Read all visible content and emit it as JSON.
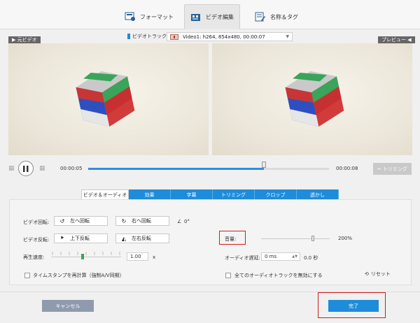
{
  "tabs": [
    {
      "label": "フォーマット",
      "icon": "format-icon"
    },
    {
      "label": "ビデオ編集",
      "icon": "video-edit-icon"
    },
    {
      "label": "名称＆タグ",
      "icon": "name-tag-icon"
    }
  ],
  "track": {
    "label": "ビデオトラック:",
    "value": "Video1: h264, 854x480, 00:00:07"
  },
  "preview": {
    "source_label": "元ビデオ",
    "preview_label": "プレビュー"
  },
  "player": {
    "current_time": "00:00:05",
    "end_time": "00:00:08",
    "trim_label": "トリミング",
    "progress": 0.73
  },
  "edit_tabs": [
    "ビデオ＆オーディオ",
    "効果",
    "字幕",
    "トリミング",
    "クロップ",
    "透かし"
  ],
  "rotate": {
    "label": "ビデオ回転:",
    "left": "左へ回転",
    "right": "右へ回転",
    "angle": "0°"
  },
  "flip": {
    "label": "ビデオ反転:",
    "vertical": "上下反転",
    "horizontal": "左右反転"
  },
  "volume": {
    "label": "音量:",
    "value": "200%",
    "level": 0.75
  },
  "speed": {
    "label": "再生速度:",
    "value": "1.00",
    "unit": "x"
  },
  "audio_delay": {
    "label": "オーディオ遅延:",
    "value": "0 ms",
    "readout": "0.0 秒"
  },
  "timestamp": {
    "label": "タイムスタンプを再計算（強制A/V同期）"
  },
  "disable_tracks": {
    "label": "全てのオーディオトラックを無効にする"
  },
  "reset_label": "リセット",
  "footer": {
    "cancel": "キャンセル",
    "done": "完了"
  },
  "colors": {
    "accent": "#1f8cda",
    "highlight": "#d21c1c",
    "cancel": "#8f9aad"
  }
}
